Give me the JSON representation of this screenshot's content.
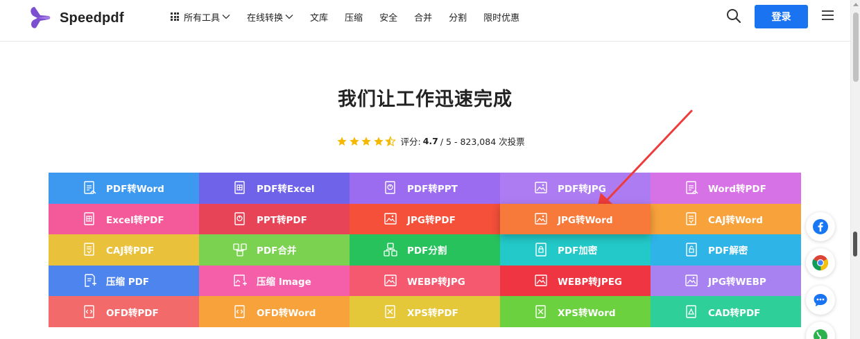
{
  "header": {
    "brand": "Speedpdf",
    "nav": [
      {
        "label": "所有工具",
        "has_grid_icon": true,
        "has_dropdown": true
      },
      {
        "label": "在线转换",
        "has_grid_icon": false,
        "has_dropdown": true
      },
      {
        "label": "文库",
        "has_grid_icon": false,
        "has_dropdown": false
      },
      {
        "label": "压缩",
        "has_grid_icon": false,
        "has_dropdown": false
      },
      {
        "label": "安全",
        "has_grid_icon": false,
        "has_dropdown": false
      },
      {
        "label": "合并",
        "has_grid_icon": false,
        "has_dropdown": false
      },
      {
        "label": "分割",
        "has_grid_icon": false,
        "has_dropdown": false
      },
      {
        "label": "限时优惠",
        "has_grid_icon": false,
        "has_dropdown": false
      }
    ],
    "login_label": "登录",
    "brand_color": "#1a73f0"
  },
  "hero": {
    "title": "我们让工作迅速完成",
    "rating": {
      "prefix": "评分:",
      "score": "4.7",
      "suffix": "/ 5 - 823,084 次投票",
      "stars": 4.5,
      "star_color": "#f5b800"
    }
  },
  "tools": [
    {
      "label": "PDF转Word",
      "color": "#3d98f0",
      "icon": "file-doc-icon"
    },
    {
      "label": "PDF转Excel",
      "color": "#6f63ea",
      "icon": "file-excel-icon"
    },
    {
      "label": "PDF转PPT",
      "color": "#9b6cf0",
      "icon": "file-ppt-icon"
    },
    {
      "label": "PDF转JPG",
      "color": "#ad7cf2",
      "icon": "file-image-icon"
    },
    {
      "label": "Word转PDF",
      "color": "#d772e6",
      "icon": "file-doc-icon"
    },
    {
      "label": "Excel转PDF",
      "color": "#f4599a",
      "icon": "file-excel-icon"
    },
    {
      "label": "PPT转PDF",
      "color": "#e84457",
      "icon": "file-ppt-icon"
    },
    {
      "label": "JPG转PDF",
      "color": "#f4503a",
      "icon": "file-image-icon"
    },
    {
      "label": "JPG转Word",
      "color": "#f77a3a",
      "icon": "file-image-icon",
      "active": true
    },
    {
      "label": "CAJ转Word",
      "color": "#f8a23c",
      "icon": "file-caj-icon"
    },
    {
      "label": "CAJ转PDF",
      "color": "#eac13b",
      "icon": "file-caj-icon"
    },
    {
      "label": "PDF合并",
      "color": "#7bd150",
      "icon": "merge-icon"
    },
    {
      "label": "PDF分割",
      "color": "#28c25d",
      "icon": "split-icon"
    },
    {
      "label": "PDF加密",
      "color": "#22c9c8",
      "icon": "lock-icon"
    },
    {
      "label": "PDF解密",
      "color": "#2eb4e6",
      "icon": "unlock-icon"
    },
    {
      "label": "压缩 PDF",
      "color": "#4d84ee",
      "icon": "compress-icon"
    },
    {
      "label": "压缩 Image",
      "color": "#f55fa9",
      "icon": "compress-image-icon"
    },
    {
      "label": "WEBP转JPG",
      "color": "#f45970",
      "icon": "file-image-icon"
    },
    {
      "label": "WEBP转JPEG",
      "color": "#ee3541",
      "icon": "file-image-icon"
    },
    {
      "label": "JPG转WEBP",
      "color": "#a982f2",
      "icon": "file-image-icon"
    },
    {
      "label": "OFD转PDF",
      "color": "#f36a6a",
      "icon": "file-code-icon"
    },
    {
      "label": "OFD转Word",
      "color": "#f8a23c",
      "icon": "file-code-icon"
    },
    {
      "label": "XPS转PDF",
      "color": "#e4c83a",
      "icon": "file-xps-icon"
    },
    {
      "label": "XPS转Word",
      "color": "#6bd13f",
      "icon": "file-xps-icon"
    },
    {
      "label": "CAD转PDF",
      "color": "#2fcf9a",
      "icon": "file-cad-icon"
    }
  ],
  "floating": [
    {
      "icon": "facebook-icon",
      "color": "#1877f2"
    },
    {
      "icon": "chrome-icon",
      "color": "#ea4335"
    },
    {
      "icon": "chat-icon",
      "color": "#1a73f0"
    },
    {
      "icon": "globe-icon",
      "color": "#2bb24c"
    }
  ],
  "annotation": {
    "arrow_color": "#ee3b3b"
  }
}
